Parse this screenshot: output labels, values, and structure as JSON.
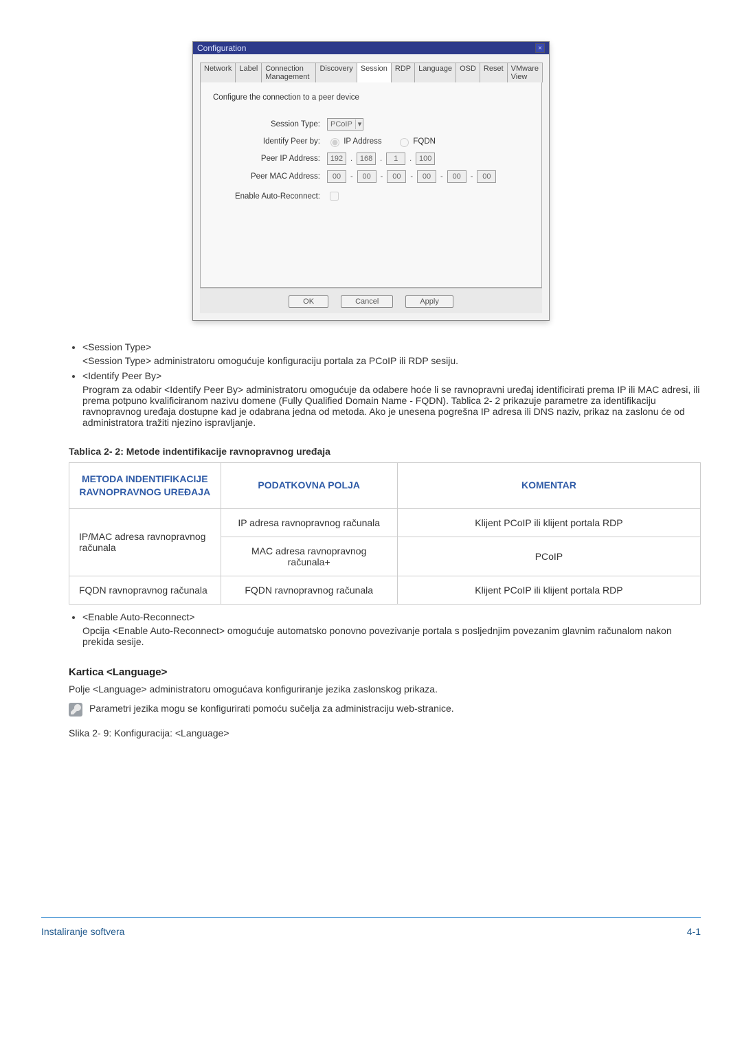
{
  "dialog": {
    "title": "Configuration",
    "tabs": [
      "Network",
      "Label",
      "Connection Management",
      "Discovery",
      "Session",
      "RDP",
      "Language",
      "OSD",
      "Reset",
      "VMware View"
    ],
    "active_tab_index": 4,
    "instruction": "Configure the connection to a peer device",
    "labels": {
      "session_type": "Session Type:",
      "identify_peer_by": "Identify Peer by:",
      "peer_ip": "Peer IP Address:",
      "peer_mac": "Peer MAC Address:",
      "enable_auto_reconnect": "Enable Auto-Reconnect:"
    },
    "values": {
      "session_type": "PCoIP",
      "radio_ip": "IP Address",
      "radio_fqdn": "FQDN",
      "ip": [
        "192",
        "168",
        "1",
        "100"
      ],
      "mac": [
        "00",
        "00",
        "00",
        "00",
        "00",
        "00"
      ]
    },
    "buttons": {
      "ok": "OK",
      "cancel": "Cancel",
      "apply": "Apply"
    }
  },
  "bullets": {
    "session_type": {
      "head": "<Session Type>",
      "body": "<Session Type> administratoru omogućuje konfiguraciju portala za PCoIP ili RDP sesiju."
    },
    "identify_peer": {
      "head": "<Identify Peer By>",
      "body": "Program za odabir <Identify Peer By> administratoru omogućuje da odabere hoće li se ravnopravni uređaj identificirati prema IP ili MAC adresi, ili prema potpuno kvalificiranom nazivu domene (Fully Qualified Domain Name - FQDN). Tablica 2- 2 prikazuje parametre za identifikaciju ravnopravnog uređaja dostupne kad je odabrana jedna od metoda. Ako je unesena pogrešna IP adresa ili DNS naziv, prikaz na zaslonu će od administratora tražiti njezino ispravljanje."
    },
    "enable_auto_reconnect": {
      "head": "<Enable Auto-Reconnect>",
      "body": "Opcija <Enable Auto-Reconnect> omogućuje automatsko ponovno povezivanje portala s posljednjim povezanim glavnim računalom nakon prekida sesije."
    }
  },
  "table": {
    "caption": "Tablica 2- 2: Metode indentifikacije ravnopravnog uređaja",
    "headers": {
      "method": "METODA INDENTIFIKACIJE RAVNOPRAVNOG UREĐAJA",
      "fields": "PODATKOVNA POLJA",
      "comment": "KOMENTAR"
    },
    "rows": {
      "r1": {
        "method": "IP/MAC adresa ravnopravnog računala",
        "field_a": "IP adresa ravnopravnog računala",
        "comment_a": "Klijent PCoIP ili klijent portala RDP",
        "field_b": "MAC adresa ravnopravnog računala+",
        "comment_b": "PCoIP"
      },
      "r2": {
        "method": "FQDN ravnopravnog računala",
        "field": "FQDN ravnopravnog računala",
        "comment": "Klijent PCoIP ili klijent portala RDP"
      }
    }
  },
  "language_section": {
    "heading": "Kartica <Language>",
    "para": "Polje <Language> administratoru omogućava konfiguriranje jezika zaslonskog prikaza.",
    "note": "Parametri jezika mogu se konfigurirati pomoću sučelja za administraciju web-stranice.",
    "fig": "Slika 2- 9: Konfiguracija: <Language>"
  },
  "footer": {
    "left": "Instaliranje softvera",
    "right": "4-1"
  }
}
